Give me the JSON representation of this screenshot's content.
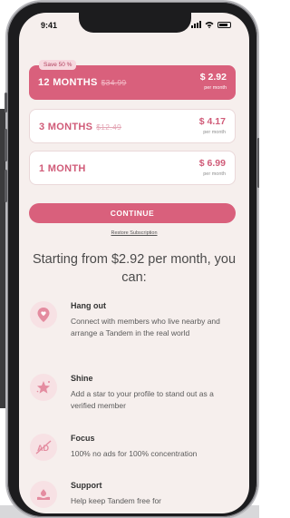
{
  "status_bar": {
    "time": "9:41"
  },
  "plans": [
    {
      "name": "12 MONTHS",
      "old_price": "$34.99",
      "price": "$ 2.92",
      "per": "per month",
      "badge": "Save 50 %"
    },
    {
      "name": "3 MONTHS",
      "old_price": "$12.49",
      "price": "$ 4.17",
      "per": "per month"
    },
    {
      "name": "1 MONTH",
      "price": "$ 6.99",
      "per": "per month"
    }
  ],
  "continue_label": "CONTINUE",
  "restore_label": "Restore Subscription",
  "headline": "Starting from $2.92 per month, you can:",
  "features": [
    {
      "icon": "pin-heart-icon",
      "title": "Hang out",
      "desc": "Connect with members who live nearby and arrange a Tandem in the real world"
    },
    {
      "icon": "star-icon",
      "title": "Shine",
      "desc": "Add a star to your profile to stand out as a verified member"
    },
    {
      "icon": "no-ads-icon",
      "title": "Focus",
      "desc": "100% no ads for 100% concentration"
    },
    {
      "icon": "support-icon",
      "title": "Support",
      "desc": "Help keep Tandem free for"
    }
  ],
  "colors": {
    "accent": "#d9607c",
    "screen_bg": "#f6efed"
  }
}
